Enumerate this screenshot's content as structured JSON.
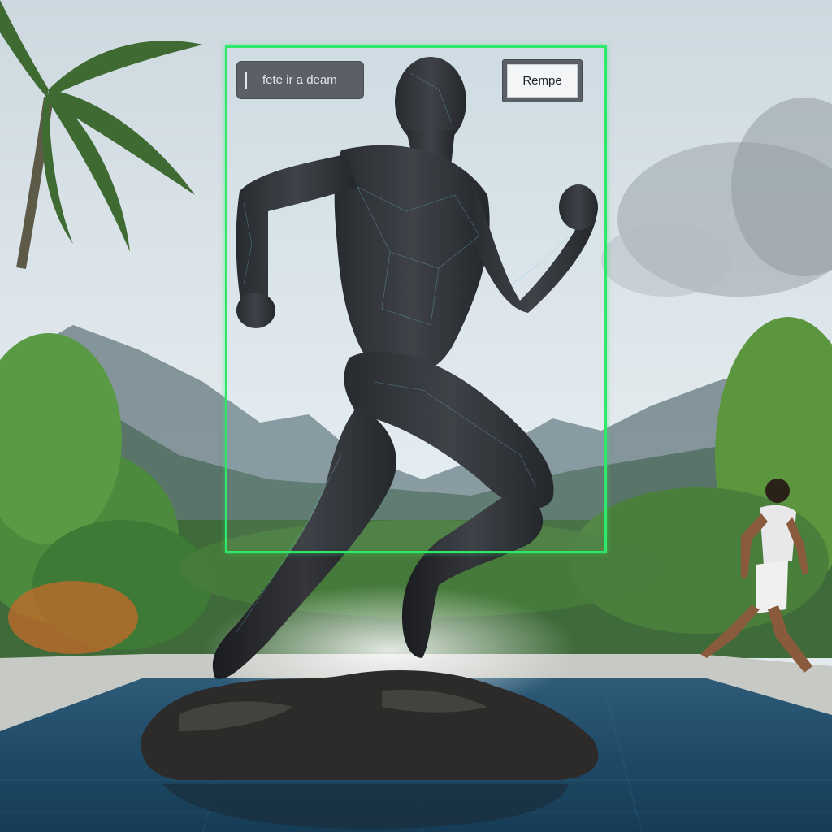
{
  "overlay": {
    "text_field": {
      "value": "fete ir a deam"
    },
    "action_button": {
      "label": "Rempe"
    },
    "frame_color": "#2ee86a"
  },
  "scene": {
    "description_icons": [
      "statue-figure",
      "palm-tree",
      "pool",
      "runner"
    ]
  }
}
